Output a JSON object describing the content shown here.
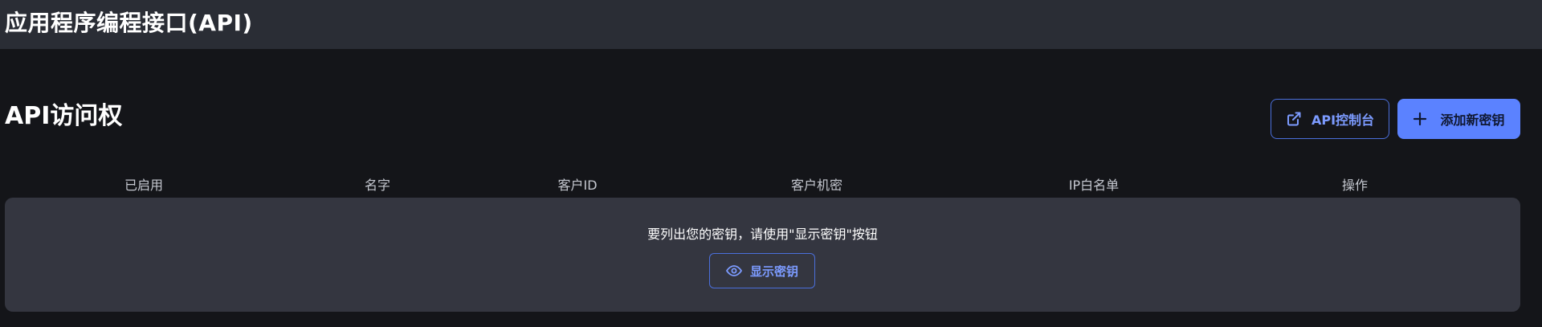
{
  "topbar": {
    "title": "应用程序编程接口(API)"
  },
  "section": {
    "title": "API访问权"
  },
  "actions": {
    "console_label": "API控制台",
    "console_icon": "external-link-icon",
    "add_label": "添加新密钥",
    "add_icon": "plus-icon"
  },
  "table": {
    "columns": [
      "已启用",
      "名字",
      "客户ID",
      "客户机密",
      "IP白名单",
      "操作"
    ]
  },
  "empty_state": {
    "message": "要列出您的密钥，请使用\"显示密钥\"按钮",
    "show_keys_label": "显示密钥",
    "show_keys_icon": "eye-icon"
  },
  "colors": {
    "background": "#141519",
    "topbar": "#2a2d35",
    "panel": "#343640",
    "accent": "#5b82ff",
    "accent_text": "#7c9bff"
  }
}
